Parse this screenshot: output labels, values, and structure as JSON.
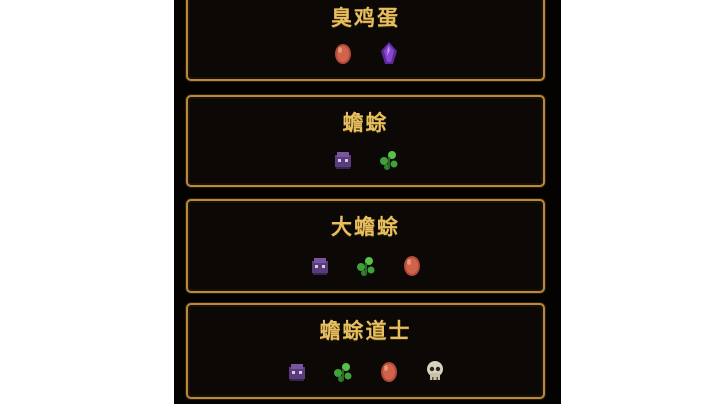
{
  "recipes": [
    {
      "title": "臭鸡蛋",
      "ingredients": [
        "red-egg-icon",
        "purple-crystal-icon"
      ]
    },
    {
      "title": "蟾蜍",
      "ingredients": [
        "purple-mushroom-icon",
        "green-herb-icon"
      ]
    },
    {
      "title": "大蟾蜍",
      "ingredients": [
        "purple-mushroom-icon",
        "green-herb-icon",
        "red-egg-icon"
      ]
    },
    {
      "title": "蟾蜍道士",
      "ingredients": [
        "purple-mushroom-icon",
        "green-herb-icon",
        "red-egg-icon",
        "skull-icon"
      ]
    }
  ],
  "colors": {
    "panel_bg": "#050302",
    "border": "#b98a3a",
    "title": "#e7bf5e"
  }
}
